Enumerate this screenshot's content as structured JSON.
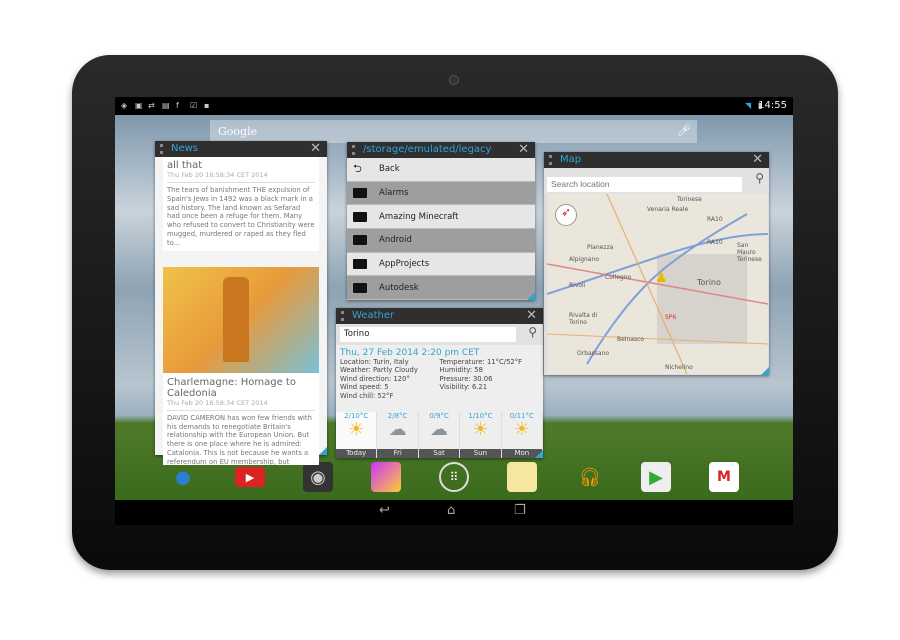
{
  "status_bar": {
    "time": "14:55",
    "icons": [
      "location-icon",
      "image-icon",
      "sync-icon",
      "sim-icon",
      "facebook-icon",
      "task-icon",
      "briefcase-icon"
    ]
  },
  "google_search": {
    "label": "Google"
  },
  "news": {
    "title": "News",
    "items": [
      {
        "title": "all that",
        "date": "Thu Feb 20 16:58:34 CET 2014",
        "body": "The tears of banishment THE expulsion of Spain's Jews in 1492 was a black mark in a sad history. The land known as Sefarad had once been a refuge for them. Many who refused to convert to Christianity were mugged, murdered or raped as they fled to..."
      },
      {
        "title": "Charlemagne: Homage to Caledonia",
        "date": "Thu Feb 20 16:58:34 CET 2014",
        "body": "DAVID CAMERON has won few friends with his demands to renegotiate Britain's relationship with the European Union. But there is one place where he is admired: Catalonia. This is not because he wants a referendum on EU membership, but becaus"
      }
    ]
  },
  "files": {
    "title": "/storage/emulated/legacy",
    "items": [
      "Back",
      "Alarms",
      "Amazing Minecraft",
      "Android",
      "AppProjects",
      "Autodesk"
    ]
  },
  "weather": {
    "title": "Weather",
    "search_value": "Torino",
    "date": "Thu, 27 Feb 2014 2:20 pm CET",
    "left": [
      "Location: Turin, Italy",
      "Weather: Partly Cloudy",
      "Wind direction: 120°",
      "Wind speed: 5",
      "Wind chill: 52°F"
    ],
    "right": [
      "Temperature: 11°C/52°F",
      "Humidity: 58",
      "Pressure: 30.06",
      "Visibility: 6.21"
    ],
    "forecast": [
      {
        "temp": "2/10°C",
        "day": "Today",
        "icon": "partly-cloudy"
      },
      {
        "temp": "2/8°C",
        "day": "Fri",
        "icon": "rain"
      },
      {
        "temp": "0/9°C",
        "day": "Sat",
        "icon": "snow-rain"
      },
      {
        "temp": "1/10°C",
        "day": "Sun",
        "icon": "sunny"
      },
      {
        "temp": "0/11°C",
        "day": "Mon",
        "icon": "partly-cloudy"
      }
    ]
  },
  "map": {
    "title": "Map",
    "search_placeholder": "Search location",
    "places": [
      "Torinese",
      "Venaria Reale",
      "RA10",
      "RA10",
      "Pianezza",
      "Alpignano",
      "San Mauro Torinese",
      "Collegno",
      "Rivoli",
      "Torino",
      "Rivalta di Torino",
      "SP6",
      "Beinasco",
      "Orbassano",
      "Nichelino"
    ]
  },
  "accent": "#33a3d6"
}
